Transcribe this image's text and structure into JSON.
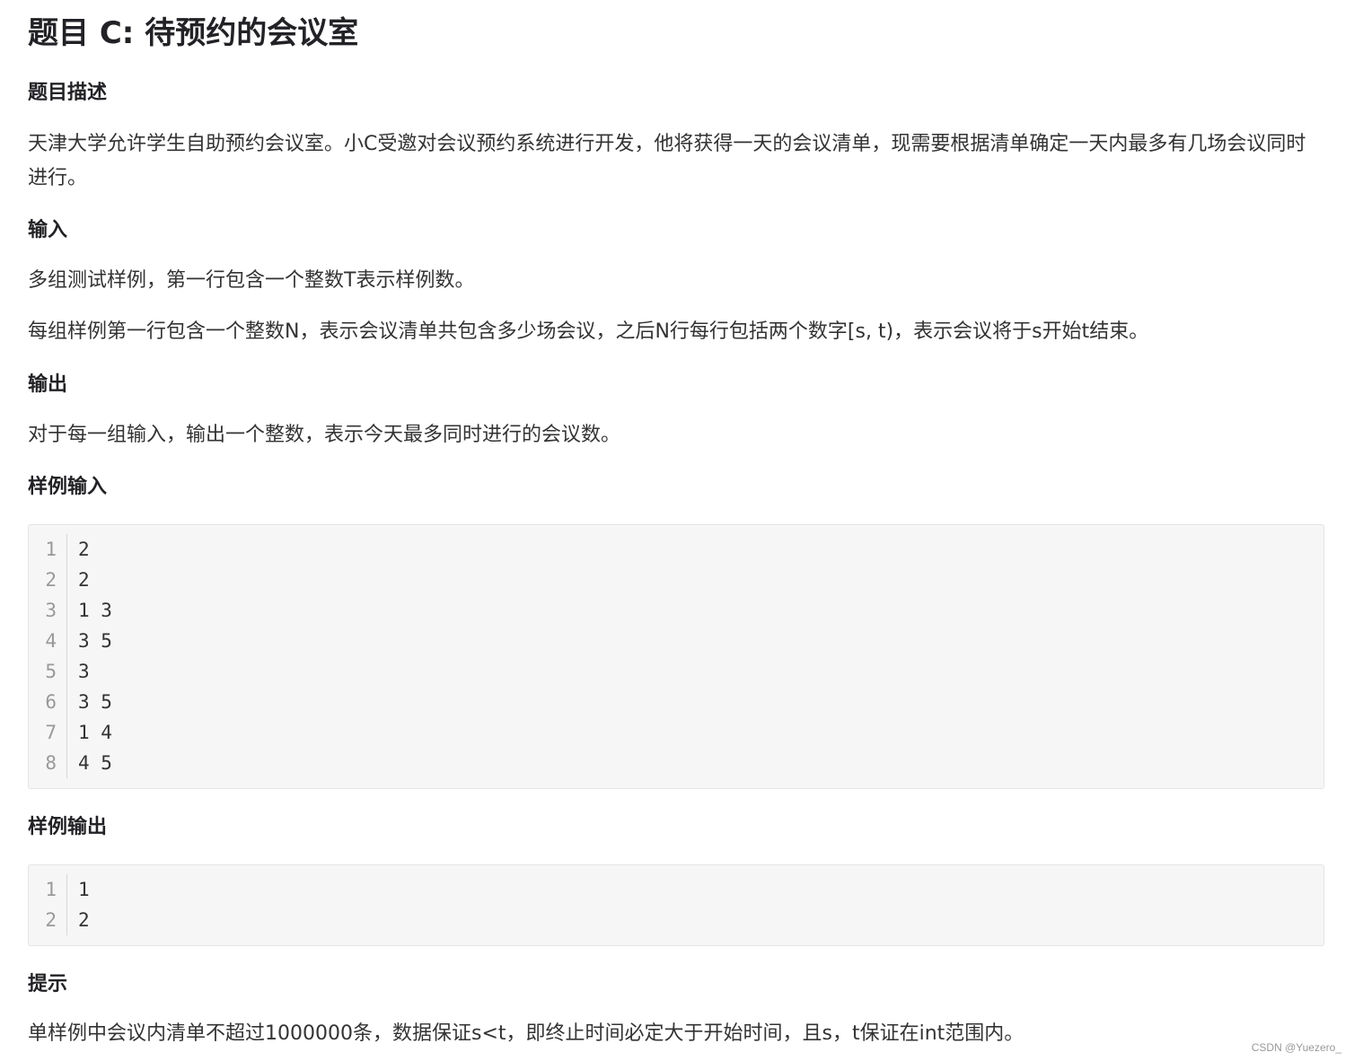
{
  "title": "题目 C: 待预约的会议室",
  "sections": {
    "description": {
      "heading": "题目描述",
      "paragraphs": [
        "天津大学允许学生自助预约会议室。小C受邀对会议预约系统进行开发，他将获得一天的会议清单，现需要根据清单确定一天内最多有几场会议同时进行。"
      ]
    },
    "input": {
      "heading": "输入",
      "paragraphs": [
        "多组测试样例，第一行包含一个整数T表示样例数。",
        "每组样例第一行包含一个整数N，表示会议清单共包含多少场会议，之后N行每行包括两个数字[s, t)，表示会议将于s开始t结束。"
      ]
    },
    "output": {
      "heading": "输出",
      "paragraphs": [
        "对于每一组输入，输出一个整数，表示今天最多同时进行的会议数。"
      ]
    },
    "sample_input": {
      "heading": "样例输入",
      "lines": [
        "2",
        "2",
        "1 3",
        "3 5",
        "3",
        "3 5",
        "1 4",
        "4 5"
      ],
      "line_numbers": [
        "1",
        "2",
        "3",
        "4",
        "5",
        "6",
        "7",
        "8"
      ]
    },
    "sample_output": {
      "heading": "样例输出",
      "lines": [
        "1",
        "2"
      ],
      "line_numbers": [
        "1",
        "2"
      ]
    },
    "hint": {
      "heading": "提示",
      "paragraphs": [
        "单样例中会议内清单不超过1000000条，数据保证s<t，即终止时间必定大于开始时间，且s，t保证在int范围内。"
      ]
    }
  },
  "watermark": "CSDN @Yuezero_"
}
